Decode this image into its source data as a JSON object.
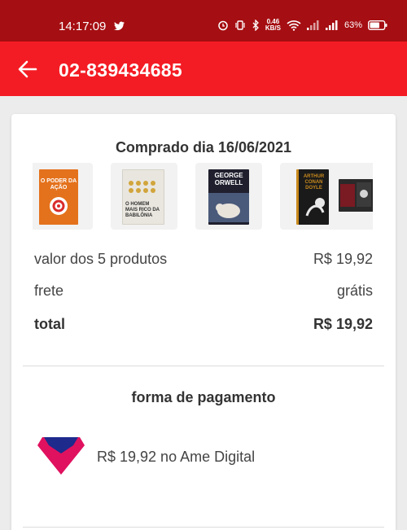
{
  "status_bar": {
    "time": "14:17:09",
    "net_speed_value": "0.46",
    "net_speed_unit": "KB/S",
    "battery": "63%"
  },
  "app_bar": {
    "title": "02-839434685",
    "back_icon": "arrow-left-icon"
  },
  "order": {
    "purchase_date": "Comprado dia 16/06/2021",
    "products": [
      {
        "cover_text": "O PODER DA AÇÃO"
      },
      {
        "cover_text": "O HOMEM MAIS RICO DA BABILÔNIA"
      },
      {
        "cover_text": "GEORGE ORWELL"
      },
      {
        "cover_text": "ARTHUR CONAN DOYLE"
      },
      {
        "cover_text": ""
      }
    ],
    "summary": {
      "products_label": "valor dos 5 produtos",
      "products_value": "R$ 19,92",
      "shipping_label": "frete",
      "shipping_value": "grátis",
      "total_label": "total",
      "total_value": "R$ 19,92"
    }
  },
  "payment": {
    "heading": "forma de pagamento",
    "method_text": "R$ 19,92 no Ame Digital",
    "method_icon": "ame-digital-logo"
  },
  "colors": {
    "status_bar": "#a50e12",
    "app_bar": "#f41c24",
    "ame_pink": "#e0115f",
    "ame_blue": "#1e2a8c"
  }
}
